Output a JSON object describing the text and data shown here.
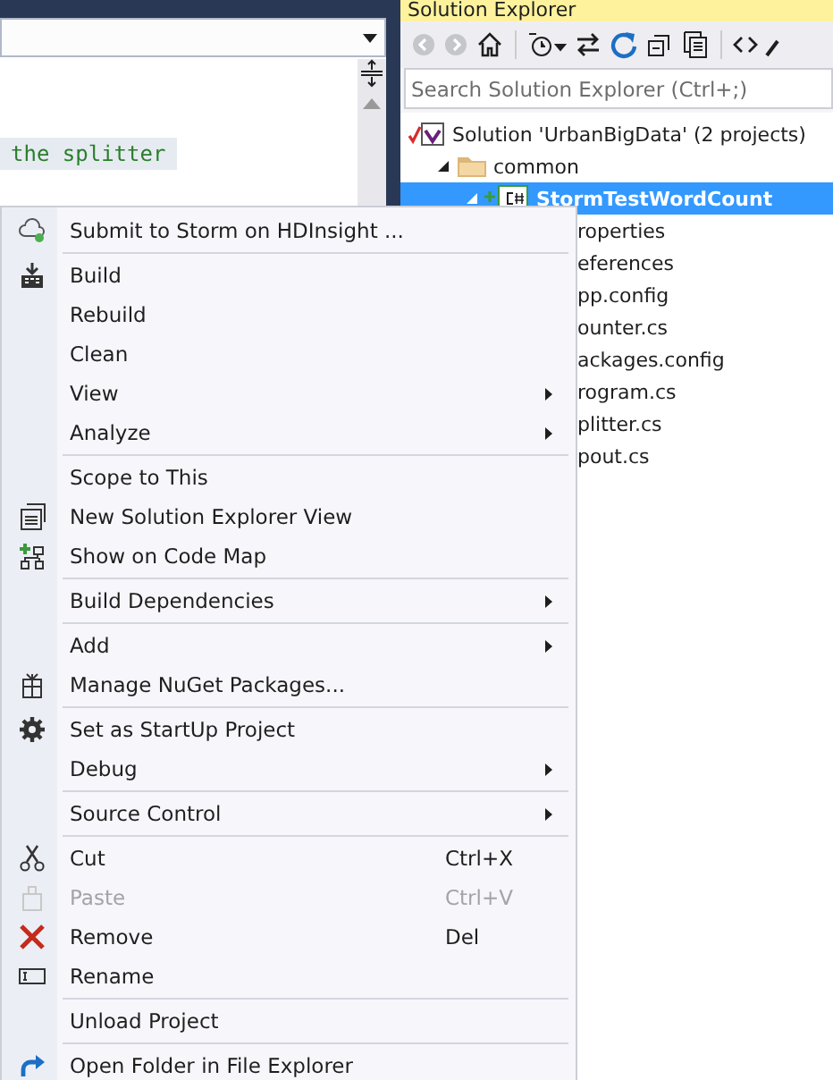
{
  "editor": {
    "code_lines": [
      {
        "text": "the splitter",
        "highlighted": true
      }
    ]
  },
  "solution_explorer": {
    "title": "Solution Explorer",
    "search": {
      "placeholder": "Search Solution Explorer (Ctrl+;)"
    },
    "tree": [
      {
        "label": "Solution 'UrbanBigData' (2 projects)",
        "selected": false,
        "children": [
          {
            "label": "common",
            "selected": false,
            "expanded": true,
            "children": [
              {
                "label": "StormTestWordCount",
                "selected": true,
                "expanded": true,
                "children": [
                  {
                    "label": "roperties",
                    "selected": false
                  },
                  {
                    "label": "eferences",
                    "selected": false
                  },
                  {
                    "label": "pp.config",
                    "selected": false
                  },
                  {
                    "label": "ounter.cs",
                    "selected": false
                  },
                  {
                    "label": "ackages.config",
                    "selected": false
                  },
                  {
                    "label": "rogram.cs",
                    "selected": false
                  },
                  {
                    "label": "plitter.cs",
                    "selected": false
                  },
                  {
                    "label": "pout.cs",
                    "selected": false
                  }
                ]
              }
            ]
          }
        ]
      }
    ]
  },
  "context_menu": {
    "groups": [
      [
        {
          "label": "Submit to Storm on HDInsight ...",
          "submenu": false,
          "disabled": false
        }
      ],
      [
        {
          "label": "Build",
          "submenu": false,
          "disabled": false
        },
        {
          "label": "Rebuild",
          "submenu": false,
          "disabled": false
        },
        {
          "label": "Clean",
          "submenu": false,
          "disabled": false
        },
        {
          "label": "View",
          "submenu": true,
          "disabled": false
        },
        {
          "label": "Analyze",
          "submenu": true,
          "disabled": false
        }
      ],
      [
        {
          "label": "Scope to This",
          "submenu": false,
          "disabled": false
        },
        {
          "label": "New Solution Explorer View",
          "submenu": false,
          "disabled": false
        },
        {
          "label": "Show on Code Map",
          "submenu": false,
          "disabled": false
        }
      ],
      [
        {
          "label": "Build Dependencies",
          "submenu": true,
          "disabled": false
        }
      ],
      [
        {
          "label": "Add",
          "submenu": true,
          "disabled": false
        },
        {
          "label": "Manage NuGet Packages...",
          "submenu": false,
          "disabled": false
        }
      ],
      [
        {
          "label": "Set as StartUp Project",
          "submenu": false,
          "disabled": false
        },
        {
          "label": "Debug",
          "submenu": true,
          "disabled": false
        }
      ],
      [
        {
          "label": "Source Control",
          "submenu": true,
          "disabled": false
        }
      ],
      [
        {
          "label": "Cut",
          "shortcut": "Ctrl+X",
          "submenu": false,
          "disabled": false
        },
        {
          "label": "Paste",
          "shortcut": "Ctrl+V",
          "submenu": false,
          "disabled": true
        },
        {
          "label": "Remove",
          "shortcut": "Del",
          "submenu": false,
          "disabled": false
        },
        {
          "label": "Rename",
          "submenu": false,
          "disabled": false
        }
      ],
      [
        {
          "label": "Unload Project",
          "submenu": false,
          "disabled": false
        }
      ],
      [
        {
          "label": "Open Folder in File Explorer",
          "submenu": false,
          "disabled": false
        }
      ]
    ]
  }
}
